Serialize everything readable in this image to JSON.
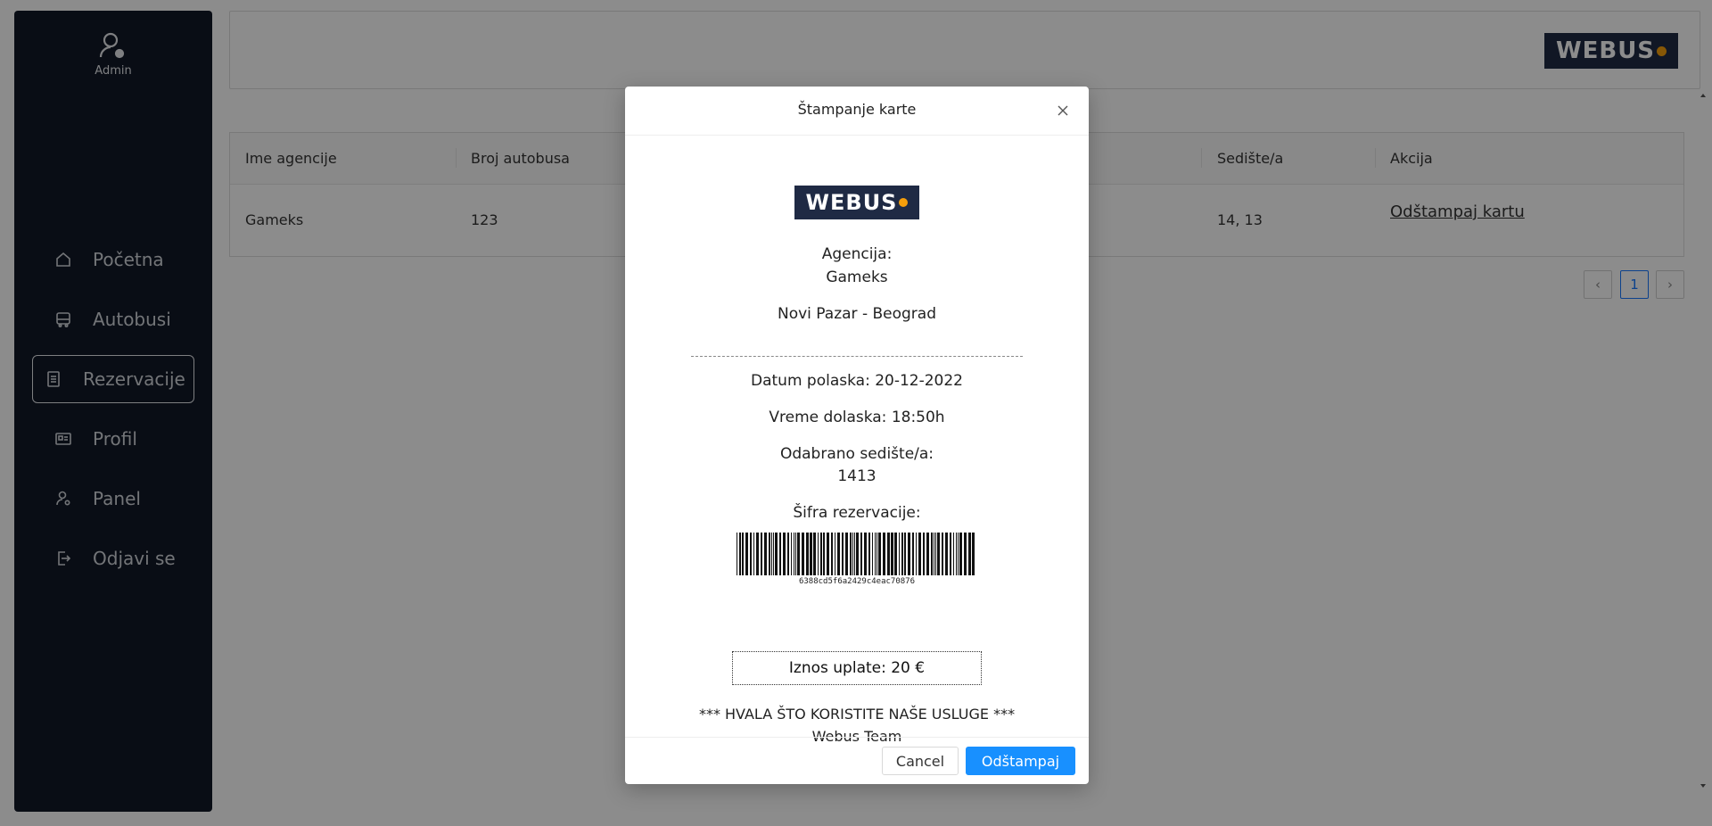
{
  "sidebar": {
    "admin_label": "Admin",
    "items": [
      {
        "label": "Početna",
        "icon": "home-icon"
      },
      {
        "label": "Autobusi",
        "icon": "bus-icon"
      },
      {
        "label": "Rezervacije",
        "icon": "document-icon",
        "active": true
      },
      {
        "label": "Profil",
        "icon": "profile-card-icon"
      },
      {
        "label": "Panel",
        "icon": "user-settings-icon"
      },
      {
        "label": "Odjavi se",
        "icon": "logout-icon"
      }
    ]
  },
  "header": {
    "logo_text": "WEBUS"
  },
  "table": {
    "columns": [
      "Ime agencije",
      "Broj autobusa",
      "Sedište/a",
      "Akcija"
    ],
    "rows": [
      {
        "agency": "Gameks",
        "bus_number": "123",
        "seats": "14, 13",
        "action": "Odštampaj kartu"
      }
    ]
  },
  "pagination": {
    "prev": "‹",
    "current": "1",
    "next": "›"
  },
  "modal": {
    "title": "Štampanje karte",
    "close": "×",
    "logo_text": "WEBUS",
    "agency_label": "Agencija:",
    "agency_value": "Gameks",
    "route": "Novi Pazar - Beograd",
    "departure": "Datum polaska: 20-12-2022",
    "arrival": "Vreme dolaska: 18:50h",
    "seat_label": "Odabrano sedište/a:",
    "seat_value": "1413",
    "code_label": "Šifra rezervacije:",
    "code_value": "6388cd5f6a2429c4eac70876",
    "amount": "Iznos uplate: 20 €",
    "thanks": "*** HVALA ŠTO KORISTITE NAŠE USLUGE ***",
    "team": "Webus Team",
    "cancel_label": "Cancel",
    "print_label": "Odštampaj"
  },
  "colors": {
    "sidebar_bg": "#111827",
    "primary": "#1890ff",
    "logo_bg": "#1f2a44",
    "logo_dot": "#f59e0b"
  }
}
